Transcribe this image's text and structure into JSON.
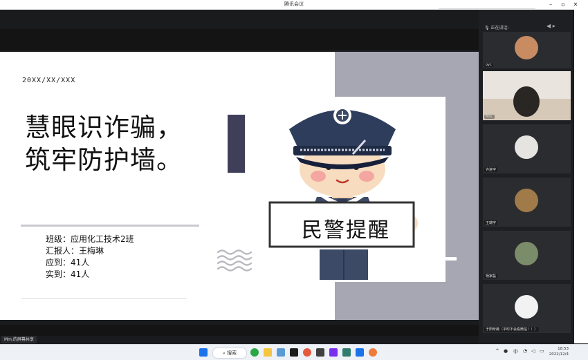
{
  "window": {
    "title": "腾讯会议"
  },
  "slide": {
    "date": "20XX/XX/XXX",
    "headline": [
      "慧眼识诈骗，",
      "筑牢防护墙。"
    ],
    "info": [
      "班级：应用化工技术2班",
      "汇报人：王梅琳",
      "应到：41人",
      "实到：41人"
    ],
    "sign_text": "民警提醒"
  },
  "sidebar": {
    "speaking_label": "正在讲话:",
    "participants": [
      {
        "name": "oyc"
      },
      {
        "name": "Mm."
      },
      {
        "name": "许进宇"
      },
      {
        "name": "王瑞宇"
      },
      {
        "name": "杨家磊"
      },
      {
        "name": "于阳昕薇（平时不会看微信！！）"
      }
    ]
  },
  "share_label": "Mm.的屏幕共享",
  "taskbar": {
    "search_label": "搜索",
    "ime": "中",
    "time": "18:53",
    "date": "2022/12/4"
  },
  "colors": {
    "slide_accent": "#3f3f5a",
    "slide_gray": "#a7a7b4",
    "meeting_bg": "#1e1f22"
  }
}
